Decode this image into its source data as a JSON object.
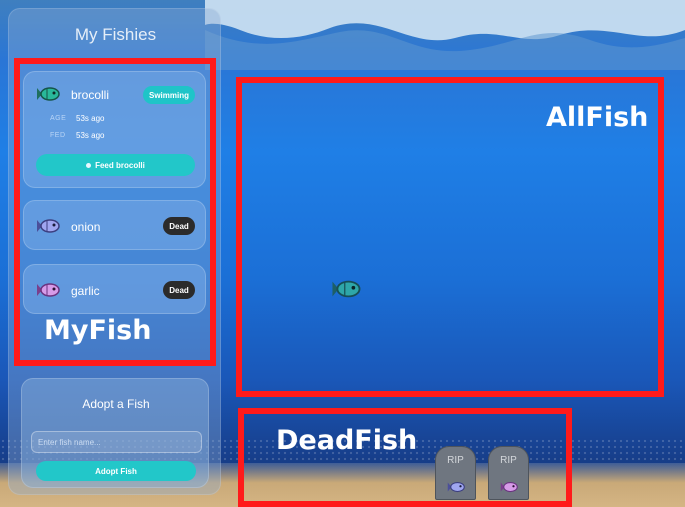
{
  "sidebar": {
    "title": "My Fishies",
    "fish": [
      {
        "name": "brocolli",
        "status": "Swimming",
        "age_label": "AGE",
        "age_value": "53s ago",
        "fed_label": "FED",
        "fed_value": "53s ago",
        "feed_label": "Feed brocolli",
        "color": "#29b89a"
      },
      {
        "name": "onion",
        "status": "Dead",
        "color": "#9fa6f0"
      },
      {
        "name": "garlic",
        "status": "Dead",
        "color": "#d79be8"
      }
    ],
    "adopt": {
      "title": "Adopt a Fish",
      "placeholder": "Enter fish name...",
      "button_label": "Adopt Fish"
    }
  },
  "annotations": {
    "myfish": "MyFish",
    "allfish": "AllFish",
    "deadfish": "DeadFish"
  },
  "tank": {
    "swimming_fish_color": "#2ea7a8"
  },
  "graveyard": {
    "tombstones": [
      {
        "label": "RIP",
        "fish_color": "#9fa6f0"
      },
      {
        "label": "RIP",
        "fish_color": "#d79be8"
      }
    ]
  },
  "colors": {
    "accent": "#22c7c9",
    "annotation_border": "#ff1a1a",
    "dead_badge": "#2b2b2b"
  }
}
